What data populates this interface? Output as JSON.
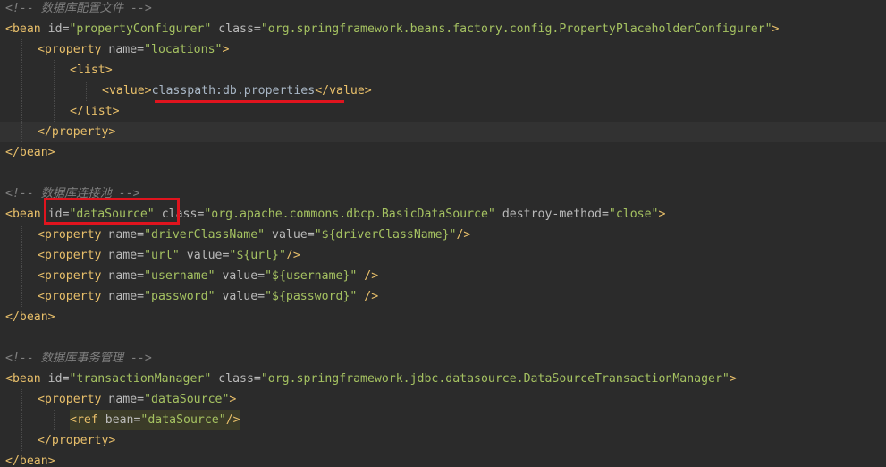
{
  "colors": {
    "background": "#2b2b2b",
    "tag": "#e8bf6a",
    "attribute": "#bababa",
    "string": "#a5c261",
    "comment": "#808080",
    "annotation": "#e0141e"
  },
  "lines": [
    {
      "tokens": [
        {
          "t": "cmt",
          "v": "<!-- 数据库配置文件 -->"
        }
      ]
    },
    {
      "tokens": [
        {
          "t": "tag",
          "v": "<bean "
        },
        {
          "t": "attr",
          "v": "id="
        },
        {
          "t": "str",
          "v": "\"propertyConfigurer\""
        },
        {
          "t": "plain",
          "v": " "
        },
        {
          "t": "attr",
          "v": "class="
        },
        {
          "t": "str",
          "v": "\"org.springframework.beans.factory.config.PropertyPlaceholderConfigurer\""
        },
        {
          "t": "tag",
          "v": ">"
        }
      ]
    },
    {
      "tokens": [
        {
          "t": "tag",
          "v": "<property "
        },
        {
          "t": "attr",
          "v": "name="
        },
        {
          "t": "str",
          "v": "\"locations\""
        },
        {
          "t": "tag",
          "v": ">"
        }
      ]
    },
    {
      "tokens": [
        {
          "t": "tag",
          "v": "<list>"
        }
      ]
    },
    {
      "tokens": [
        {
          "t": "tag",
          "v": "<value>"
        },
        {
          "t": "plain",
          "v": "classpath:db.properties"
        },
        {
          "t": "tag",
          "v": "</value>"
        }
      ]
    },
    {
      "tokens": [
        {
          "t": "tag",
          "v": "</list>"
        }
      ]
    },
    {
      "tokens": [
        {
          "t": "tag",
          "v": "</property>"
        }
      ]
    },
    {
      "tokens": [
        {
          "t": "tag",
          "v": "</bean>"
        }
      ]
    },
    {
      "tokens": []
    },
    {
      "tokens": [
        {
          "t": "cmt",
          "v": "<!-- 数据库连接池 -->"
        }
      ]
    },
    {
      "tokens": [
        {
          "t": "tag",
          "v": "<bean "
        },
        {
          "t": "attr",
          "v": "id="
        },
        {
          "t": "str",
          "v": "\"dataSource\""
        },
        {
          "t": "plain",
          "v": " "
        },
        {
          "t": "attr",
          "v": "class="
        },
        {
          "t": "str",
          "v": "\"org.apache.commons.dbcp.BasicDataSource\""
        },
        {
          "t": "plain",
          "v": " "
        },
        {
          "t": "attr",
          "v": "destroy-method="
        },
        {
          "t": "str",
          "v": "\"close\""
        },
        {
          "t": "tag",
          "v": ">"
        }
      ]
    },
    {
      "tokens": [
        {
          "t": "tag",
          "v": "<property "
        },
        {
          "t": "attr",
          "v": "name="
        },
        {
          "t": "str",
          "v": "\"driverClassName\""
        },
        {
          "t": "plain",
          "v": " "
        },
        {
          "t": "attr",
          "v": "value="
        },
        {
          "t": "str",
          "v": "\"${driverClassName}\""
        },
        {
          "t": "tag",
          "v": "/>"
        }
      ]
    },
    {
      "tokens": [
        {
          "t": "tag",
          "v": "<property "
        },
        {
          "t": "attr",
          "v": "name="
        },
        {
          "t": "str",
          "v": "\"url\""
        },
        {
          "t": "plain",
          "v": " "
        },
        {
          "t": "attr",
          "v": "value="
        },
        {
          "t": "str",
          "v": "\"${url}\""
        },
        {
          "t": "tag",
          "v": "/>"
        }
      ]
    },
    {
      "tokens": [
        {
          "t": "tag",
          "v": "<property "
        },
        {
          "t": "attr",
          "v": "name="
        },
        {
          "t": "str",
          "v": "\"username\""
        },
        {
          "t": "plain",
          "v": " "
        },
        {
          "t": "attr",
          "v": "value="
        },
        {
          "t": "str",
          "v": "\"${username}\""
        },
        {
          "t": "plain",
          "v": " "
        },
        {
          "t": "tag",
          "v": "/>"
        }
      ]
    },
    {
      "tokens": [
        {
          "t": "tag",
          "v": "<property "
        },
        {
          "t": "attr",
          "v": "name="
        },
        {
          "t": "str",
          "v": "\"password\""
        },
        {
          "t": "plain",
          "v": " "
        },
        {
          "t": "attr",
          "v": "value="
        },
        {
          "t": "str",
          "v": "\"${password}\""
        },
        {
          "t": "plain",
          "v": " "
        },
        {
          "t": "tag",
          "v": "/>"
        }
      ]
    },
    {
      "tokens": [
        {
          "t": "tag",
          "v": "</bean>"
        }
      ]
    },
    {
      "tokens": []
    },
    {
      "tokens": [
        {
          "t": "cmt",
          "v": "<!-- 数据库事务管理 -->"
        }
      ]
    },
    {
      "tokens": [
        {
          "t": "tag",
          "v": "<bean "
        },
        {
          "t": "attr",
          "v": "id="
        },
        {
          "t": "str",
          "v": "\"transactionManager\""
        },
        {
          "t": "plain",
          "v": " "
        },
        {
          "t": "attr",
          "v": "class="
        },
        {
          "t": "str",
          "v": "\"org.springframework.jdbc.datasource.DataSourceTransactionManager\""
        },
        {
          "t": "tag",
          "v": ">"
        }
      ]
    },
    {
      "tokens": [
        {
          "t": "tag",
          "v": "<property "
        },
        {
          "t": "attr",
          "v": "name="
        },
        {
          "t": "str",
          "v": "\"dataSource\""
        },
        {
          "t": "tag",
          "v": ">"
        }
      ]
    },
    {
      "tokens": [
        {
          "t": "tag",
          "v": "<ref "
        },
        {
          "t": "attr",
          "v": "bean="
        },
        {
          "t": "str",
          "v": "\"dataSource\""
        },
        {
          "t": "tag",
          "v": "/>"
        }
      ]
    },
    {
      "tokens": [
        {
          "t": "tag",
          "v": "</property>"
        }
      ]
    },
    {
      "tokens": [
        {
          "t": "tag",
          "v": "</bean>"
        }
      ]
    }
  ]
}
